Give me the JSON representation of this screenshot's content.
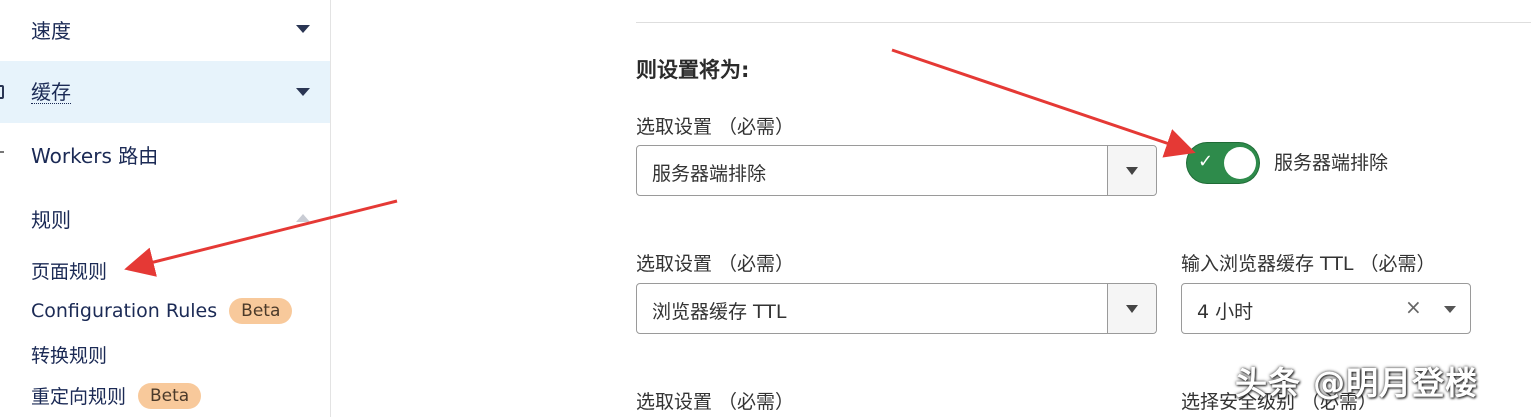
{
  "sidebar": {
    "items": [
      {
        "label": "速度"
      },
      {
        "label": "缓存"
      },
      {
        "label": "Workers 路由"
      },
      {
        "label": "规则"
      }
    ],
    "subitems": [
      {
        "label": "页面规则"
      },
      {
        "label": "Configuration Rules",
        "badge": "Beta"
      },
      {
        "label": "转换规则"
      },
      {
        "label": "重定向规则",
        "badge": "Beta"
      }
    ]
  },
  "main": {
    "section_title": "则设置将为:",
    "rows": [
      {
        "label": "选取设置 （必需）",
        "value": "服务器端排除",
        "toggle_label": "服务器端排除",
        "toggle_on": true
      },
      {
        "label": "选取设置 （必需）",
        "value": "浏览器缓存 TTL",
        "secondary_label": "输入浏览器缓存 TTL （必需）",
        "secondary_value": "4 小时",
        "secondary_clear": "×"
      },
      {
        "label": "选取设置 （必需）",
        "secondary_label": "选择安全级别 （必需）"
      }
    ]
  },
  "watermark": "头条 @明月登楼",
  "colors": {
    "accent_nav": "#e7f3fb",
    "toggle_on": "#2e8b4b",
    "badge": "#f8c99b",
    "arrow": "#e53935"
  },
  "icons": [
    "chevron-down-icon",
    "chevron-up-icon",
    "check-icon",
    "clear-icon"
  ]
}
